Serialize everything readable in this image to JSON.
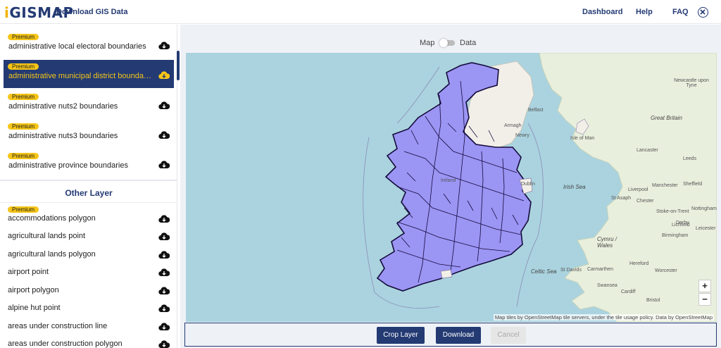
{
  "header": {
    "logo_prefix": "i",
    "logo_rest": "GISMAP",
    "app_title": "Download GIS Data",
    "nav": [
      "Dashboard",
      "Help",
      "FAQ"
    ]
  },
  "sidebar": {
    "premium_badge": "Premium",
    "premium_items": [
      {
        "label": "administrative local electoral boundaries",
        "selected": false
      },
      {
        "label": "administrative municipal district boundaries",
        "selected": true
      },
      {
        "label": "administrative nuts2 boundaries",
        "selected": false
      },
      {
        "label": "administrative nuts3 boundaries",
        "selected": false
      },
      {
        "label": "administrative province boundaries",
        "selected": false
      }
    ],
    "other_title": "Other Layer",
    "other_items": [
      {
        "label": "accommodations polygon",
        "premium": true
      },
      {
        "label": "agricultural lands point",
        "premium": false
      },
      {
        "label": "agricultural lands polygon",
        "premium": false
      },
      {
        "label": "airport point",
        "premium": false
      },
      {
        "label": "airport polygon",
        "premium": false
      },
      {
        "label": "alpine hut point",
        "premium": false
      },
      {
        "label": "areas under construction line",
        "premium": false
      },
      {
        "label": "areas under construction polygon",
        "premium": false
      }
    ]
  },
  "toggle": {
    "left": "Map",
    "right": "Data"
  },
  "map": {
    "zoom_in": "+",
    "zoom_out": "−",
    "attribution": "Map tiles by OpenStreetMap tile servers, under the tile usage policy. Data by OpenStreetMap",
    "places": [
      "Belfast",
      "Armagh",
      "Newry",
      "Isle of Man",
      "Dublin",
      "Ireland",
      "Newcastle upon Tyne",
      "Great Britain",
      "Lancaster",
      "Leeds",
      "Manchester",
      "Sheffield",
      "Liverpool",
      "St Asaph",
      "Chester",
      "Stoke-on-Trent",
      "Derby",
      "Nottingham",
      "Lichfield",
      "Leicester",
      "Birmingham",
      "Worcester",
      "Hereford",
      "Cardiff",
      "Swansea",
      "Bristol",
      "Irish Sea",
      "Celtic Sea",
      "St Davids",
      "Carmarthen",
      "Cymru / Wales"
    ],
    "colors": {
      "sea": "#aad3df",
      "land": "#f2efe9",
      "ireland": "#9b95f4",
      "boundary": "#1a1040"
    }
  },
  "actions": {
    "crop": "Crop Layer",
    "download": "Download",
    "cancel": "Cancel"
  }
}
